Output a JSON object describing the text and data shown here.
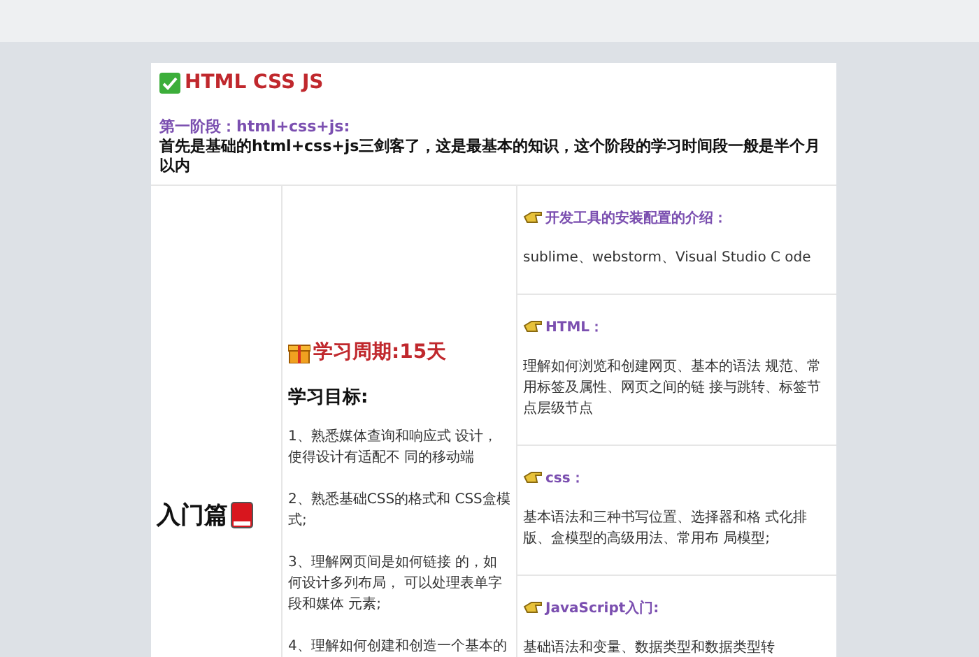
{
  "header": {
    "title": "HTML CSS JS"
  },
  "stage": {
    "heading": "第一阶段：html+css+js:",
    "description": "首先是基础的html+css+js三剑客了，这是最基本的知识，这个阶段的学习时间段一般是半个月以内"
  },
  "table": {
    "level_label": "入门篇",
    "period": "学习周期:15天",
    "goals_heading": "学习目标:",
    "goals": [
      "1、熟悉媒体查询和响应式 设计，使得设计有适配不 同的移动端",
      "2、熟悉基础CSS的格式和 CSS盒模式;",
      "3、理解网页间是如何链接 的，如何设计多列布局， 可以处理表单字段和媒体 元素;",
      "4、理解如何创建和创造一个基本的"
    ],
    "topics": [
      {
        "title": "开发工具的安装配置的介绍：",
        "body": "sublime、webstorm、Visual Studio C ode"
      },
      {
        "title": "HTML：",
        "body": "理解如何浏览和创建网页、基本的语法 规范、常用标签及属性、网页之间的链 接与跳转、标签节点层级节点"
      },
      {
        "title": "css：",
        "body": "基本语法和三种书写位置、选择器和格 式化排版、盒模型的高级用法、常用布 局模型;"
      },
      {
        "title": "JavaScript入门:",
        "body": "基础语法和变量、数据类型和数据类型转"
      }
    ]
  }
}
